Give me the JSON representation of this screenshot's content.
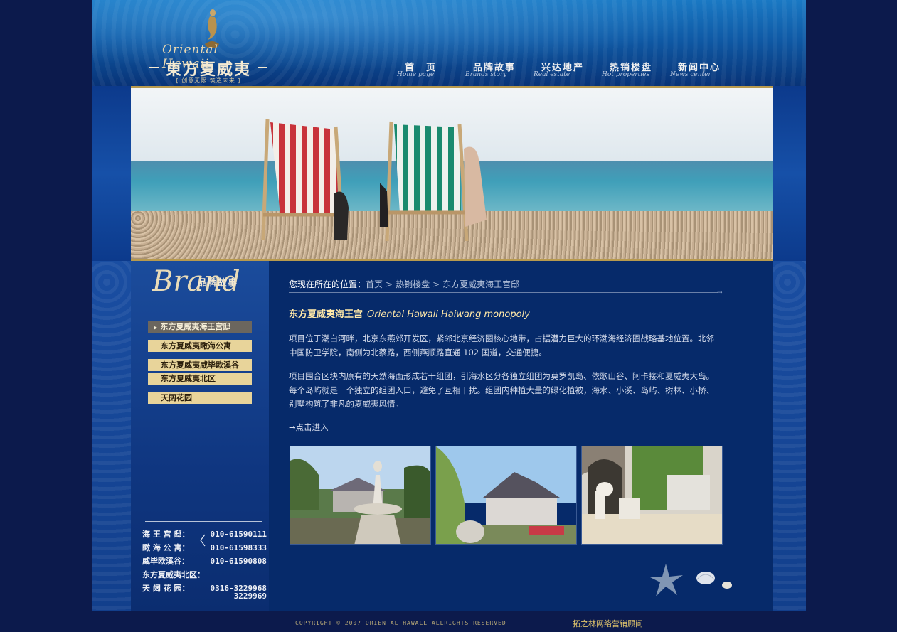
{
  "header": {
    "logo": {
      "en": "Oriental Hawaii",
      "cn": "東方夏威夷",
      "slogan": "[ 创意无限 筑造未来 ]"
    },
    "nav": [
      {
        "cn": "首　页",
        "en": "Home page"
      },
      {
        "cn": "品牌故事",
        "en": "Brands story"
      },
      {
        "cn": "兴达地产",
        "en": "Real estate"
      },
      {
        "cn": "热销楼盘",
        "en": "Hot properties"
      },
      {
        "cn": "新闻中心",
        "en": "News center"
      }
    ]
  },
  "sidebar": {
    "brand_script": "Brand",
    "brand_cn": "品牌故事",
    "items": [
      {
        "label": "东方夏威夷海王宫邸"
      },
      {
        "label": "东方夏威夷瞰海公寓"
      },
      {
        "label": "东方夏威夷威毕欧溪谷"
      },
      {
        "label": "东方夏威夷北区"
      },
      {
        "label": "天阔花园"
      }
    ],
    "contacts": [
      {
        "name": "海 王 宫 邸：",
        "phone": "010-61590111"
      },
      {
        "name": "瞰 海 公 寓：",
        "phone": "010-61598333"
      },
      {
        "name": "威毕欧溪谷：",
        "phone": "010-61590808"
      },
      {
        "name": "东方夏威夷北区：",
        "phone": ""
      },
      {
        "name": "天 阔 花 园：",
        "phone": "0316-3229968"
      },
      {
        "name": "",
        "phone": "3229969"
      }
    ]
  },
  "breadcrumb": {
    "label": "您现在所在的位置：",
    "items": [
      "首页",
      "热销楼盘",
      "东方夏威夷海王宫邸"
    ],
    "sep": ">"
  },
  "main": {
    "title_cn": "东方夏威夷海王宫",
    "title_en": "Oriental Hawaii Haiwang monopoly",
    "p1": "项目位于潮白河畔，北京东燕郊开发区，紧邻北京经济圈核心地带，占据潜力巨大的环渤海经济圈战略基地位置。北邻中国防卫学院，南侧为北蔡路，西侧燕顺路直通 102 国道，交通便捷。",
    "p2": "项目围合区块内原有的天然海面形成若干组团，引海水区分各独立组团为莫罗凯岛、依歌山谷、阿卡接和夏威夷大岛。每个岛屿就是一个独立的组团入口，避免了互相干扰。组团内种植大量的绿化植被，海水、小溪、岛屿、树林、小桥、别墅构筑了非凡的夏威夷风情。",
    "enter": "→点击进入"
  },
  "footer": {
    "copyright": "COPYRIGHT © 2007 ORIENTAL HAWALL ALLRIGHTS RESERVED",
    "credit": "拓之林网络营销顾问"
  },
  "colors": {
    "page_bg": "#0c1a4c",
    "main_bg": "#062a6a",
    "menu_bg": "#e8d49a",
    "menu_active": "#6b665e",
    "title": "#ffe8a8"
  }
}
